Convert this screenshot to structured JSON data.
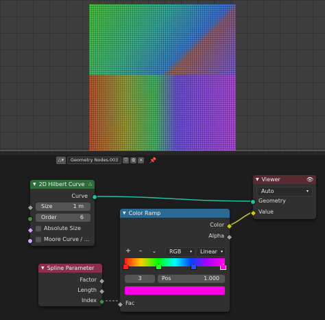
{
  "editor": {
    "node_tree": "Geometry Nodes.003"
  },
  "nodes": {
    "hilbert": {
      "title": "2D Hilbert Curve",
      "output_curve": "Curve",
      "size_label": "Size",
      "size_value": "1 m",
      "order_label": "Order",
      "order_value": "6",
      "absolute_size_label": "Absolute Size",
      "moore_label": "Moore Curve / ..."
    },
    "viewer": {
      "title": "Viewer",
      "domain": "Auto",
      "geometry_label": "Geometry",
      "value_label": "Value"
    },
    "color_ramp": {
      "title": "Color Ramp",
      "color_label": "Color",
      "alpha_label": "Alpha",
      "add": "+",
      "remove": "–",
      "color_mode": "RGB",
      "interpolation": "Linear",
      "stop_index": "3",
      "pos_label": "Pos",
      "pos_value": "1.000",
      "fac_label": "Fac",
      "selected_color": "#ff00e6"
    },
    "spline": {
      "title": "Spline Parameter",
      "factor_label": "Factor",
      "length_label": "Length",
      "index_label": "Index"
    }
  },
  "colors": {
    "accent_header_geometry": "#2f6e3a",
    "accent_header_converter": "#2b6a93",
    "accent_header_input": "#8a2f4e",
    "accent_header_output": "#5a2a33",
    "socket_geometry": "#20c0a0",
    "socket_float": "#a0a0a0",
    "socket_int": "#4a8a4a",
    "socket_color": "#c7c72c",
    "socket_bool": "#d8a6ff"
  }
}
